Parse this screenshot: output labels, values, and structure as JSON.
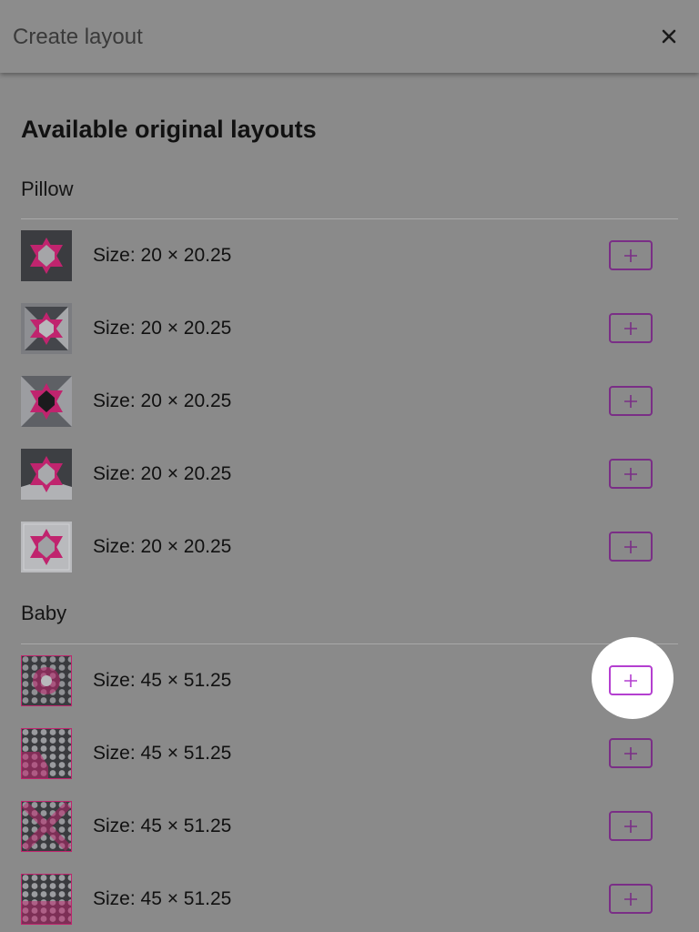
{
  "header": {
    "title": "Create layout",
    "close_icon": "close-icon"
  },
  "main": {
    "heading": "Available original layouts",
    "sections": [
      {
        "title": "Pillow",
        "items": [
          {
            "label": "Size: 20 × 20.25",
            "thumbnail": "star-block-1"
          },
          {
            "label": "Size: 20 × 20.25",
            "thumbnail": "star-block-2"
          },
          {
            "label": "Size: 20 × 20.25",
            "thumbnail": "star-block-3"
          },
          {
            "label": "Size: 20 × 20.25",
            "thumbnail": "star-block-4"
          },
          {
            "label": "Size: 20 × 20.25",
            "thumbnail": "star-block-5"
          }
        ]
      },
      {
        "title": "Baby",
        "items": [
          {
            "label": "Size: 45 × 51.25",
            "thumbnail": "hexagon-quilt-1"
          },
          {
            "label": "Size: 45 × 51.25",
            "thumbnail": "hexagon-quilt-2"
          },
          {
            "label": "Size: 45 × 51.25",
            "thumbnail": "hexagon-quilt-3"
          },
          {
            "label": "Size: 45 × 51.25",
            "thumbnail": "hexagon-quilt-4"
          }
        ]
      }
    ]
  },
  "colors": {
    "background": "#8a8a8a",
    "accent": "#7a2e86",
    "highlight_accent": "#b43fd0",
    "star_pink": "#c0246e"
  }
}
